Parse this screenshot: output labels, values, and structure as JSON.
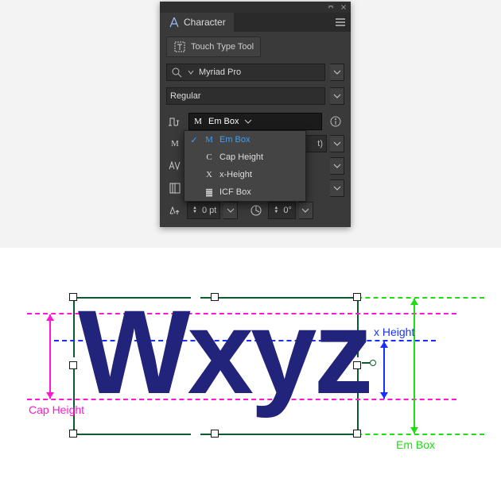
{
  "panel": {
    "title": "Character",
    "touch_tool": "Touch Type Tool",
    "font_family": "Myriad Pro",
    "font_style": "Regular",
    "sizing_ref_selected": "Em Box",
    "sizing_ref_options": [
      {
        "glyph": "M",
        "label": "Em Box",
        "selected": true
      },
      {
        "glyph": "C",
        "label": "Cap Height",
        "selected": false
      },
      {
        "glyph": "X",
        "label": "x-Height",
        "selected": false
      },
      {
        "glyph": "䷀",
        "label": "ICF Box",
        "selected": false
      }
    ],
    "baseline_shift": "0 pt",
    "rotation": "0°"
  },
  "diagram": {
    "sample_text": "Wxyz",
    "labels": {
      "em_box": "Em Box",
      "cap_height": "Cap Height",
      "x_height": "x Height"
    },
    "colors": {
      "em_box": "#1ede12",
      "cap_height": "#ff17d3",
      "x_height": "#1730ff",
      "selection": "#0a5c2a"
    }
  }
}
